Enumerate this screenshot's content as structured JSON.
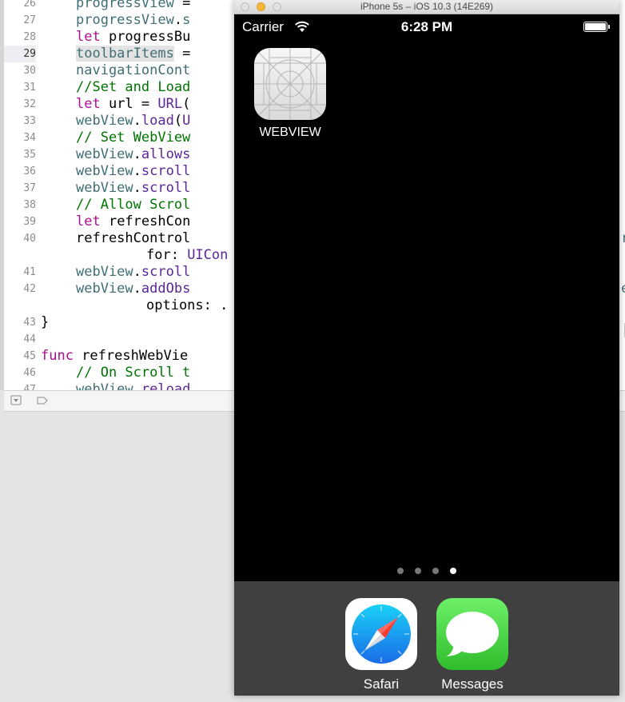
{
  "editor": {
    "current_line": "29",
    "lines": [
      {
        "num": "26",
        "tokens": [
          {
            "t": "progressView",
            "c": "prop"
          },
          {
            "t": " = ",
            "c": "plain"
          }
        ]
      },
      {
        "num": "27",
        "tokens": [
          {
            "t": "progressView",
            "c": "prop"
          },
          {
            "t": ".",
            "c": "plain"
          },
          {
            "t": "s",
            "c": "prop"
          }
        ]
      },
      {
        "num": "28",
        "tokens": [
          {
            "t": "let",
            "c": "kw"
          },
          {
            "t": " progressBu",
            "c": "plain"
          }
        ]
      },
      {
        "num": "29",
        "tokens": [
          {
            "t": "toolbarItems",
            "c": "prop-hl"
          },
          {
            "t": " =",
            "c": "plain"
          }
        ]
      },
      {
        "num": "30",
        "tokens": [
          {
            "t": "navigationCont",
            "c": "prop"
          }
        ]
      },
      {
        "num": "31",
        "tokens": [
          {
            "t": "//Set and Load",
            "c": "comment"
          }
        ]
      },
      {
        "num": "32",
        "tokens": [
          {
            "t": "let",
            "c": "kw"
          },
          {
            "t": " url = ",
            "c": "plain"
          },
          {
            "t": "URL",
            "c": "type"
          },
          {
            "t": "(",
            "c": "plain"
          }
        ]
      },
      {
        "num": "33",
        "tokens": [
          {
            "t": "webView",
            "c": "prop"
          },
          {
            "t": ".",
            "c": "plain"
          },
          {
            "t": "load",
            "c": "type"
          },
          {
            "t": "(",
            "c": "plain"
          },
          {
            "t": "U",
            "c": "type"
          }
        ]
      },
      {
        "num": "34",
        "tokens": [
          {
            "t": "// Set WebView",
            "c": "comment"
          }
        ]
      },
      {
        "num": "35",
        "tokens": [
          {
            "t": "webView",
            "c": "prop"
          },
          {
            "t": ".",
            "c": "plain"
          },
          {
            "t": "allows",
            "c": "type"
          }
        ]
      },
      {
        "num": "36",
        "tokens": [
          {
            "t": "webView",
            "c": "prop"
          },
          {
            "t": ".",
            "c": "plain"
          },
          {
            "t": "scroll",
            "c": "type"
          }
        ]
      },
      {
        "num": "37",
        "tokens": [
          {
            "t": "webView",
            "c": "prop"
          },
          {
            "t": ".",
            "c": "plain"
          },
          {
            "t": "scroll",
            "c": "type"
          }
        ]
      },
      {
        "num": "38",
        "tokens": [
          {
            "t": "// Allow Scrol",
            "c": "comment"
          }
        ]
      },
      {
        "num": "39",
        "tokens": [
          {
            "t": "let",
            "c": "kw"
          },
          {
            "t": " refreshCon",
            "c": "plain"
          }
        ]
      },
      {
        "num": "40",
        "tokens": [
          {
            "t": "refreshControl",
            "c": "plain"
          }
        ]
      },
      {
        "num": "",
        "indent": 2,
        "tokens": [
          {
            "t": "for: ",
            "c": "plain"
          },
          {
            "t": "UICon",
            "c": "type"
          }
        ]
      },
      {
        "num": "41",
        "tokens": [
          {
            "t": "webView",
            "c": "prop"
          },
          {
            "t": ".",
            "c": "plain"
          },
          {
            "t": "scroll",
            "c": "type"
          }
        ]
      },
      {
        "num": "42",
        "tokens": [
          {
            "t": "webView",
            "c": "prop"
          },
          {
            "t": ".",
            "c": "plain"
          },
          {
            "t": "addObs",
            "c": "type"
          }
        ]
      },
      {
        "num": "",
        "indent": 2,
        "tokens": [
          {
            "t": "options: .",
            "c": "plain"
          }
        ]
      },
      {
        "num": "43",
        "indent": -1,
        "tokens": [
          {
            "t": "}",
            "c": "plain"
          }
        ]
      },
      {
        "num": "44",
        "tokens": []
      },
      {
        "num": "45",
        "indent": -1,
        "tokens": [
          {
            "t": "func",
            "c": "kw"
          },
          {
            "t": " refreshWebVie",
            "c": "plain"
          }
        ]
      },
      {
        "num": "46",
        "tokens": [
          {
            "t": "// On Scroll t",
            "c": "comment"
          }
        ]
      },
      {
        "num": "47",
        "tokens": [
          {
            "t": "webView",
            "c": "prop"
          },
          {
            "t": ".",
            "c": "plain"
          },
          {
            "t": "reload",
            "c": "type"
          }
        ]
      }
    ],
    "edge_chars": [
      {
        "row": 14,
        "char": "r"
      },
      {
        "row": 17,
        "char": "e"
      }
    ]
  },
  "simulator": {
    "title": "iPhone 5s – iOS 10.3 (14E269)",
    "status": {
      "carrier": "Carrier",
      "time": "6:28 PM",
      "battery_level": 1.0
    },
    "home_apps": [
      {
        "name": "WEBVIEW",
        "icon": "blank-app-icon"
      }
    ],
    "page_dots": {
      "count": 4,
      "active": 3
    },
    "dock": [
      {
        "name": "Safari",
        "icon": "safari-compass-icon"
      },
      {
        "name": "Messages",
        "icon": "messages-bubble-icon"
      }
    ]
  },
  "colors": {
    "keyword": "#aa0d91",
    "property": "#3f6e74",
    "type": "#5c2699",
    "comment": "#007400",
    "dock_bg": "#404040"
  }
}
